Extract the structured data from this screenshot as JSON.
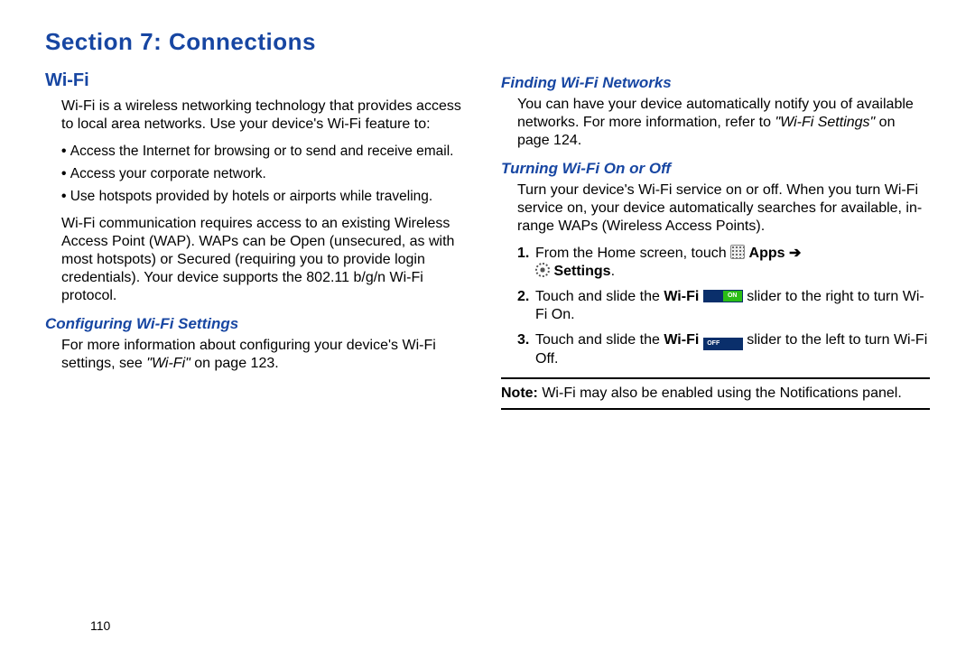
{
  "title": "Section 7: Connections",
  "page": "110",
  "left": {
    "h1": "Wi-Fi",
    "p1": "Wi-Fi is a wireless networking technology that provides access to local area networks. Use your device's Wi-Fi feature to:",
    "bullets": [
      "Access the Internet for browsing or to send and receive email.",
      "Access your corporate network.",
      "Use hotspots provided by hotels or airports while traveling."
    ],
    "p2": "Wi-Fi communication requires access to an existing Wireless Access Point (WAP). WAPs can be Open (unsecured, as with most hotspots) or Secured (requiring you to provide login credentials). Your device supports the 802.11 b/g/n Wi-Fi protocol.",
    "h2": "Configuring Wi-Fi Settings",
    "p3a": "For more information about configuring your device's Wi-Fi settings, see ",
    "p3ref": "\"Wi-Fi\"",
    "p3b": " on page 123."
  },
  "right": {
    "h1": "Finding Wi-Fi Networks",
    "p1a": "You can have your device automatically notify you of available networks. For more information, refer to ",
    "p1ref": "\"Wi-Fi Settings\"",
    "p1b": "  on page 124.",
    "h2": "Turning Wi-Fi On or Off",
    "p2": "Turn your device's Wi-Fi service on or off. When you turn Wi-Fi service on, your device automatically searches for available, in-range WAPs (Wireless Access Points).",
    "step1_num": "1.",
    "step1_a": "From the Home screen, touch ",
    "step1_apps": " Apps ",
    "step1_arrow": "➔",
    "step1_settings": " Settings",
    "step1_dot": ".",
    "step2_num": "2.",
    "step2_a": "Touch and slide the ",
    "step2_wifi": "Wi-Fi ",
    "slider_on": "ON",
    "step2_b": " slider to the right to turn Wi-Fi On.",
    "step3_num": "3.",
    "step3_a": "Touch and slide the ",
    "step3_wifi": "Wi-Fi ",
    "slider_off": "OFF",
    "step3_b": " slider to the left to turn Wi-Fi Off.",
    "note_label": "Note: ",
    "note_text": "Wi-Fi may also be enabled using the Notifications panel."
  }
}
